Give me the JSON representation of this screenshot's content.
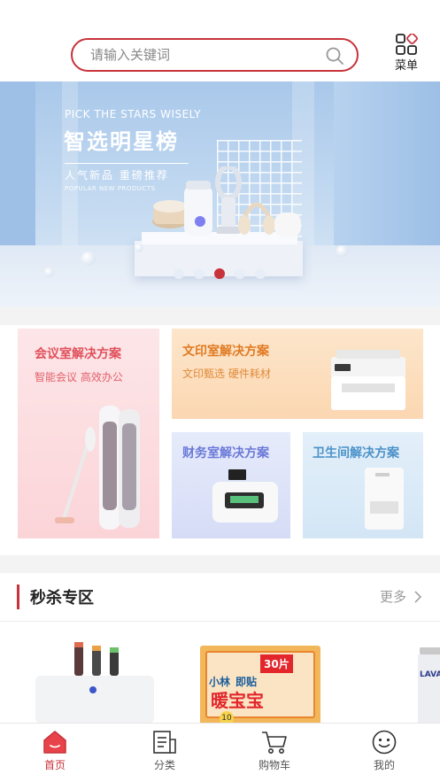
{
  "search": {
    "placeholder": "请输入关键词"
  },
  "menu": {
    "label": "菜单"
  },
  "banner": {
    "subtitle": "PICK THE STARS WISELY",
    "title": "智选明星榜",
    "tagline": "人气新品 重磅推荐",
    "small": "POPULAR NEW PRODUCTS",
    "slide_count": 5,
    "active_slide": 3
  },
  "solutions": [
    {
      "title": "会议室解决方案",
      "subtitle": "智能会议 高效办公"
    },
    {
      "title": "文印室解决方案",
      "subtitle": "文印甄选 硬件耗材"
    },
    {
      "title": "财务室解决方案"
    },
    {
      "title": "卫生间解决方案"
    }
  ],
  "flash_sale": {
    "title": "秒杀专区",
    "more": "更多"
  },
  "products": [
    {
      "name": "knife-sterilizer-image"
    },
    {
      "name": "warm-patch-box-image",
      "brand": "小林",
      "label": "即贴",
      "big": "暖宝宝",
      "count": "30片",
      "small": "10"
    },
    {
      "name": "hand-cream-image",
      "brand": "LAVAN"
    }
  ],
  "tabs": [
    {
      "label": "首页",
      "active": true
    },
    {
      "label": "分类"
    },
    {
      "label": "购物车"
    },
    {
      "label": "我的"
    }
  ],
  "colors": {
    "accent": "#c8323a",
    "divider": "#f3f3f3"
  }
}
